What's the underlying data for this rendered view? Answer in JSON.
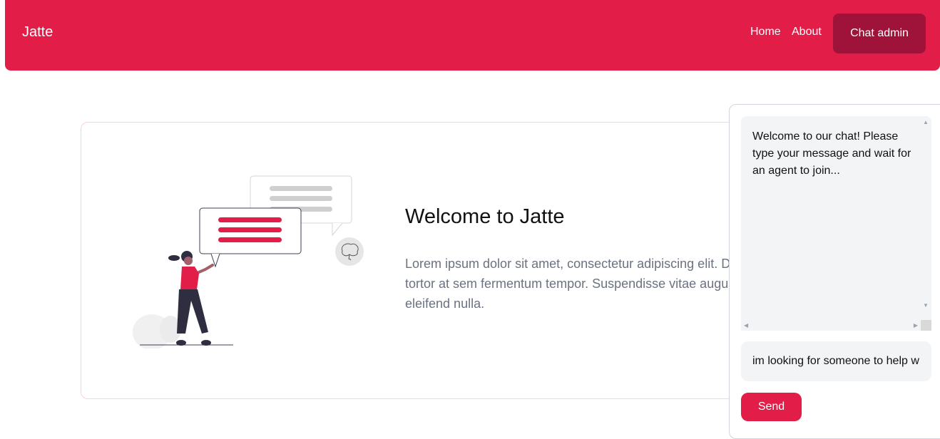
{
  "navbar": {
    "brand": "Jatte",
    "links": [
      {
        "label": "Home"
      },
      {
        "label": "About"
      }
    ],
    "cta_label": "Chat admin",
    "color": "#e11d48",
    "cta_color": "#9f1239"
  },
  "hero": {
    "title": "Welcome to Jatte",
    "lines": [
      "Lorem ipsum dolor sit amet, consectetur adipiscing elit. D",
      "tortor at sem fermentum tempor. Suspendisse vitae augue",
      "eleifend nulla."
    ]
  },
  "chat": {
    "welcome_message": "Welcome to our chat! Please type your message and wait for an agent to join...",
    "input_value": "im looking for someone to help w",
    "send_label": "Send"
  }
}
